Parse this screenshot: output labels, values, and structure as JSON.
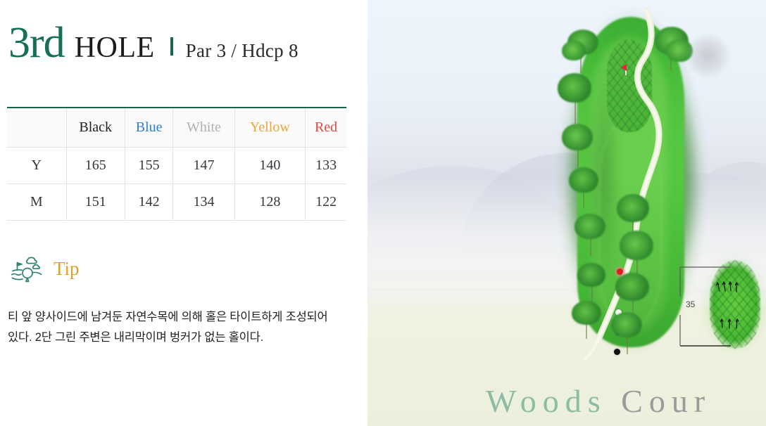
{
  "header": {
    "hole_number": "3rd",
    "hole_word": "HOLE",
    "meta": "Par 3 / Hdcp 8",
    "divider_color": "#15654f",
    "number_color": "#157056"
  },
  "yardage_table": {
    "corner_label": "",
    "columns": [
      {
        "label": "Black",
        "color": "#1f1f1f"
      },
      {
        "label": "Blue",
        "color": "#2d7fd3"
      },
      {
        "label": "White",
        "color": "#b0b0b0"
      },
      {
        "label": "Yellow",
        "color": "#e8a838"
      },
      {
        "label": "Red",
        "color": "#e8453c"
      }
    ],
    "rows": [
      {
        "label": "Y",
        "values": [
          "165",
          "155",
          "147",
          "140",
          "133"
        ]
      },
      {
        "label": "M",
        "values": [
          "151",
          "142",
          "134",
          "128",
          "122"
        ]
      }
    ]
  },
  "tip": {
    "icon": "golf-course-icon",
    "title": "Tip",
    "title_color": "#e0a02c",
    "body": "티 앞 양사이드에 남겨둔 자연수목에 의해 홀은 타이트하게 조성되어 있다. 2단 그린 주변은 내리막이며 벙커가 없는 홀이다."
  },
  "course_map": {
    "dimension_label": "35",
    "pin_color": "#e8233a",
    "tee_markers": [
      {
        "name": "red",
        "color": "#d81f26"
      },
      {
        "name": "yellow",
        "color": "#e0756a"
      },
      {
        "name": "white",
        "color": "#ffffff"
      },
      {
        "name": "blue",
        "color": "#1a2fb0"
      },
      {
        "name": "black",
        "color": "#121212"
      }
    ]
  },
  "watermark": {
    "word_green": "Woods",
    "word_gray": "Cour",
    "green_color": "#8cbda4",
    "gray_color": "#9b9b9b"
  }
}
